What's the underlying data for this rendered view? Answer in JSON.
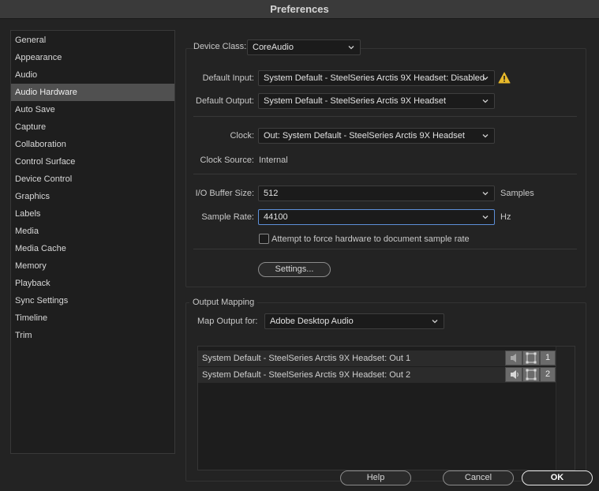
{
  "window": {
    "title": "Preferences"
  },
  "sidebar": {
    "items": [
      {
        "label": "General"
      },
      {
        "label": "Appearance"
      },
      {
        "label": "Audio"
      },
      {
        "label": "Audio Hardware",
        "selected": true
      },
      {
        "label": "Auto Save"
      },
      {
        "label": "Capture"
      },
      {
        "label": "Collaboration"
      },
      {
        "label": "Control Surface"
      },
      {
        "label": "Device Control"
      },
      {
        "label": "Graphics"
      },
      {
        "label": "Labels"
      },
      {
        "label": "Media"
      },
      {
        "label": "Media Cache"
      },
      {
        "label": "Memory"
      },
      {
        "label": "Playback"
      },
      {
        "label": "Sync Settings"
      },
      {
        "label": "Timeline"
      },
      {
        "label": "Trim"
      }
    ]
  },
  "device": {
    "class_label": "Device Class:",
    "class_value": "CoreAudio",
    "default_input_label": "Default Input:",
    "default_input_value": "System Default - SteelSeries Arctis 9X Headset: Disabled",
    "default_output_label": "Default Output:",
    "default_output_value": "System Default - SteelSeries Arctis 9X Headset",
    "clock_label": "Clock:",
    "clock_value": "Out: System Default - SteelSeries Arctis 9X Headset",
    "clock_source_label": "Clock Source:",
    "clock_source_value": "Internal",
    "buffer_label": "I/O Buffer Size:",
    "buffer_value": "512",
    "buffer_unit": "Samples",
    "sample_rate_label": "Sample Rate:",
    "sample_rate_value": "44100",
    "sample_rate_unit": "Hz",
    "force_rate_label": "Attempt to force hardware to document sample rate",
    "force_rate_checked": false,
    "settings_button": "Settings..."
  },
  "output_mapping": {
    "section_title": "Output Mapping",
    "map_for_label": "Map Output for:",
    "map_for_value": "Adobe Desktop Audio",
    "rows": [
      {
        "label": "System Default - SteelSeries Arctis 9X Headset: Out 1",
        "channel": "1"
      },
      {
        "label": "System Default - SteelSeries Arctis 9X Headset: Out 2",
        "channel": "2"
      }
    ]
  },
  "footer": {
    "help": "Help",
    "cancel": "Cancel",
    "ok": "OK"
  },
  "colors": {
    "warning": "#e8b92a",
    "focus": "#5d8fd8",
    "selection": "#505050"
  }
}
